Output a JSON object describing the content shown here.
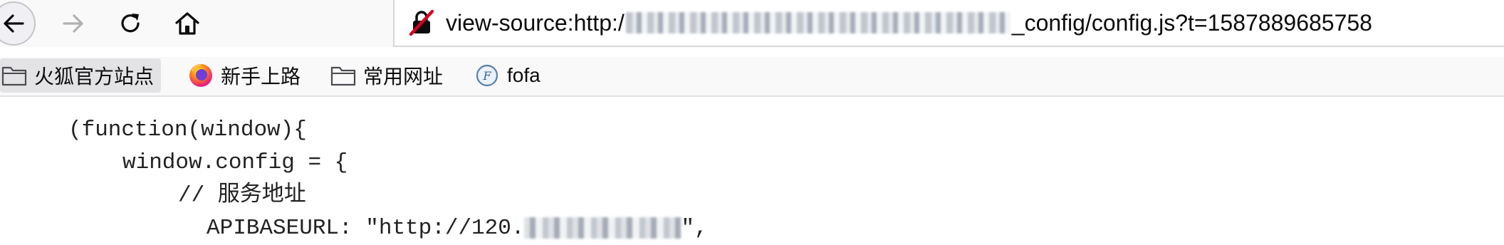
{
  "toolbar": {
    "url_prefix": "view-source:http:/",
    "url_suffix": "_config/config.js?t=1587889685758"
  },
  "bookmarks": [
    {
      "label": "火狐官方站点",
      "icon": "folder-icon"
    },
    {
      "label": "新手上路",
      "icon": "firefox-icon"
    },
    {
      "label": "常用网址",
      "icon": "folder-icon"
    },
    {
      "label": "fofa",
      "icon": "fofa-icon"
    }
  ],
  "source": {
    "line1": "(function(window){",
    "line2": "window.config = {",
    "line3": "// 服务地址",
    "line4_prefix": "APIBASEURL: \"http://120.",
    "line4_suffix": "\","
  },
  "colors": {
    "toolbar_bg": "#f9f9fa",
    "insecure_lock": "#d70022",
    "firefox_orange": "#ff6611"
  }
}
